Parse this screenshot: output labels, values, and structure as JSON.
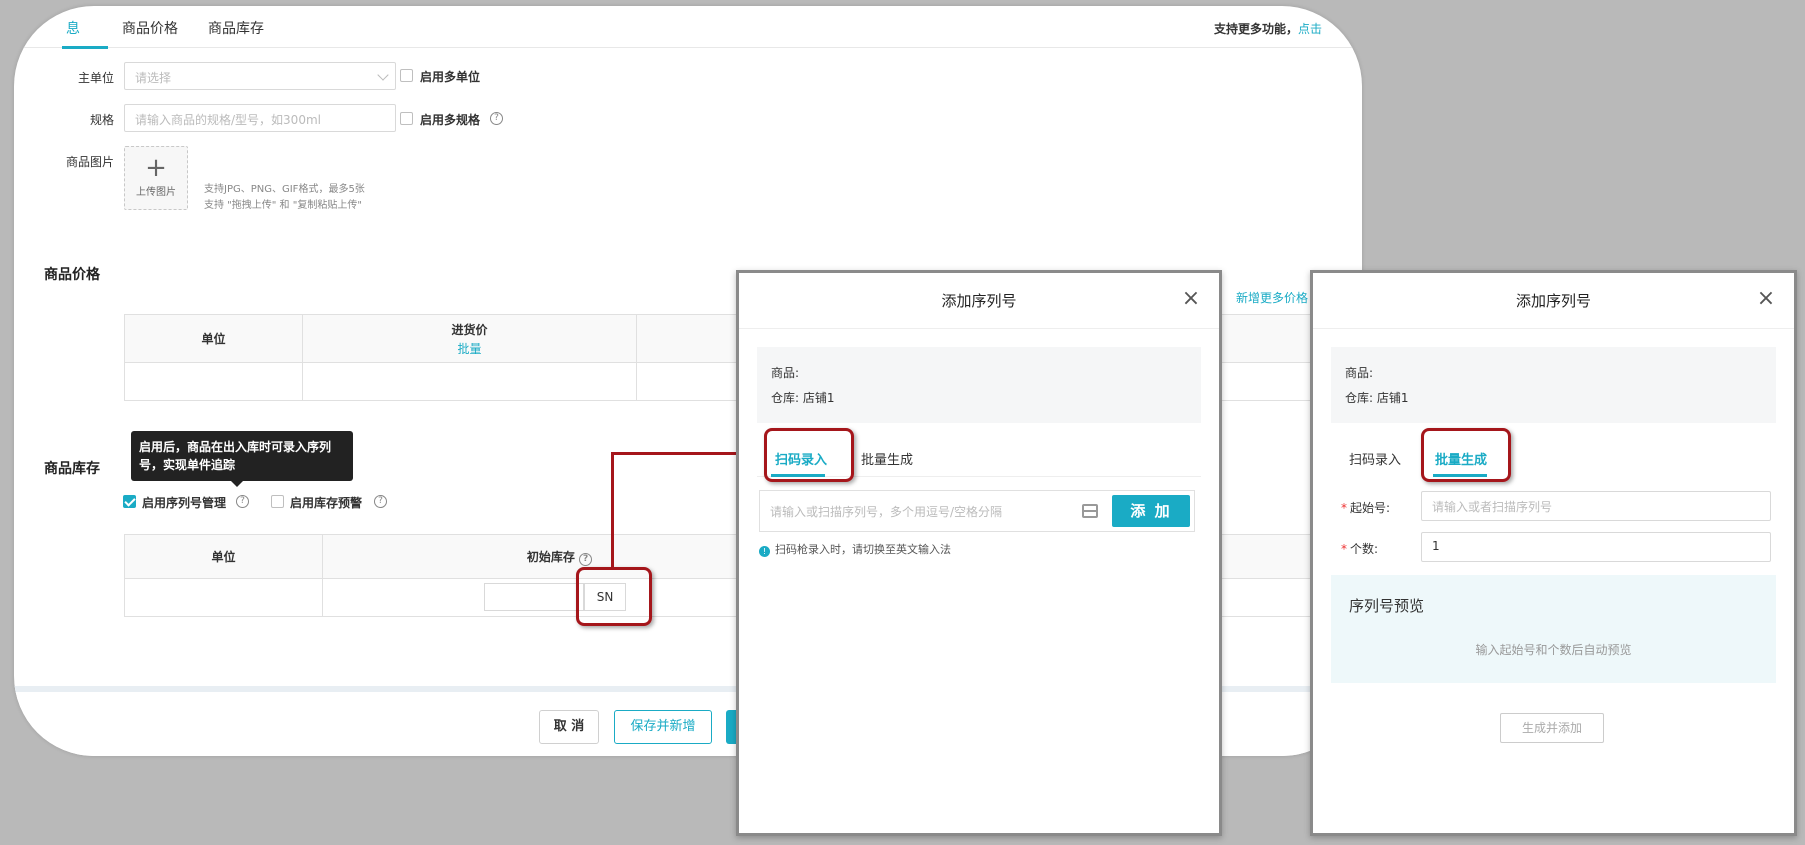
{
  "main": {
    "tabs": [
      {
        "label": "息",
        "active": true
      },
      {
        "label": "商品价格",
        "active": false
      },
      {
        "label": "商品库存",
        "active": false
      }
    ],
    "top_note": "支持更多功能，",
    "top_note_link": "点击",
    "unit_label": "主单位",
    "unit_placeholder": "请选择",
    "multi_unit": "启用多单位",
    "spec_label": "规格",
    "spec_placeholder": "请输入商品的规格/型号，如300ml",
    "multi_spec": "启用多规格",
    "image_label": "商品图片",
    "upload_text": "上传图片",
    "upload_hint_1": "支持JPG、PNG、GIF格式，最多5张",
    "upload_hint_2": "支持 \"拖拽上传\" 和 \"复制粘贴上传\"",
    "price_section": "商品价格",
    "price_more_link": "新增更多价格",
    "price_table": {
      "col_unit": "单位",
      "col_purchase": "进货价",
      "col_purchase_link": "批量"
    },
    "stock_section": "商品库存",
    "tooltip": "启用后，商品在出入库时可录入序列号，实现单件追踪",
    "serial_toggle": "启用序列号管理",
    "stock_alert": "启用库存预警",
    "stock_table": {
      "col_unit": "单位",
      "col_initial": "初始库存"
    },
    "sn_button": "SN",
    "footer": {
      "cancel": "取 消",
      "save_new": "保存并新增"
    }
  },
  "dialog_scan": {
    "title": "添加序列号",
    "product_label": "商品:",
    "warehouse_label": "仓库:",
    "warehouse_value": "店铺1",
    "tab_scan": "扫码录入",
    "tab_batch": "批量生成",
    "scan_placeholder": "请输入或扫描序列号，多个用逗号/空格分隔",
    "add_button": "添 加",
    "hint": "扫码枪录入时，请切换至英文输入法"
  },
  "dialog_batch": {
    "title": "添加序列号",
    "product_label": "商品:",
    "warehouse_label": "仓库:",
    "warehouse_value": "店铺1",
    "tab_scan": "扫码录入",
    "tab_batch": "批量生成",
    "start_label": "起始号:",
    "start_placeholder": "请输入或者扫描序列号",
    "count_label": "个数:",
    "count_value": "1",
    "preview_title": "序列号预览",
    "preview_hint": "输入起始号和个数后自动预览",
    "generate_button": "生成并添加"
  },
  "colors": {
    "accent": "#1aabc5",
    "highlight": "#a5161b",
    "background": "#b9b9b9"
  }
}
